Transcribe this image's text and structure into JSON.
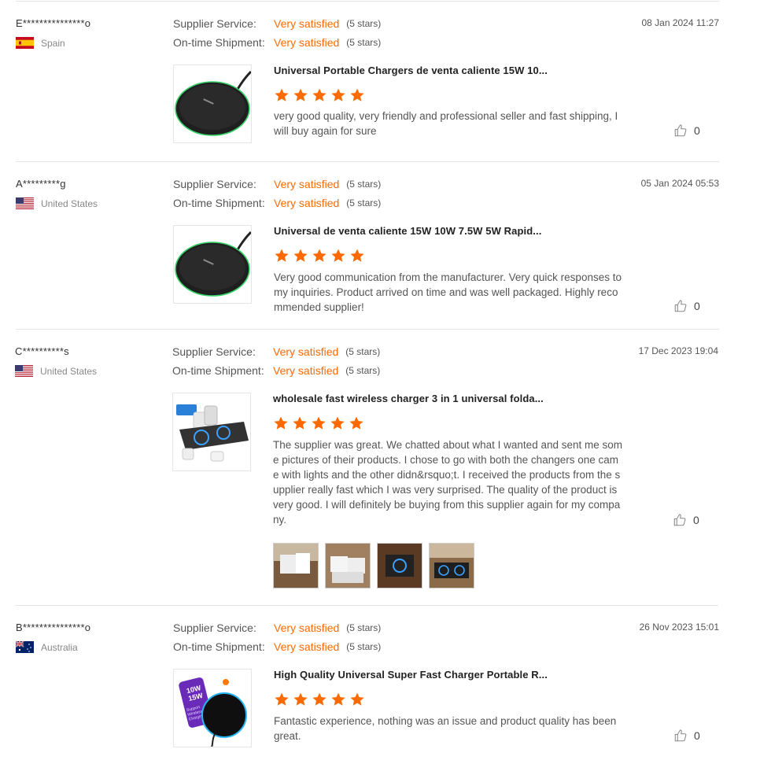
{
  "labels": {
    "supplier_service": "Supplier Service:",
    "ontime_shipment": "On-time Shipment:"
  },
  "colors": {
    "accent": "#ff6a00",
    "divider": "#e5e5e5"
  },
  "reviews": [
    {
      "name": "E***************o",
      "country": "Spain",
      "flag_icon": "spain-flag-icon",
      "supplier_service": "Very satisfied",
      "supplier_service_stars": "(5 stars)",
      "ontime_shipment": "Very satisfied",
      "ontime_shipment_stars": "(5 stars)",
      "date": "08 Jan 2024 11:27",
      "product_title": "Universal Portable Chargers de venta caliente 15W 10...",
      "rating": 5,
      "text": "very good quality, very friendly and professional seller and fast shipping, I will buy again for sure",
      "likes": "0"
    },
    {
      "name": "A*********g",
      "country": "United States",
      "flag_icon": "usa-flag-icon",
      "supplier_service": "Very satisfied",
      "supplier_service_stars": "(5 stars)",
      "ontime_shipment": "Very satisfied",
      "ontime_shipment_stars": "(5 stars)",
      "date": "05 Jan 2024 05:53",
      "product_title": "Universal de venta caliente 15W 10W 7.5W 5W Rapid...",
      "rating": 5,
      "text": "Very good communication from the manufacturer. Very quick responses to my inquiries. Product arrived on time and was well packaged. Highly recommended supplier!",
      "likes": "0"
    },
    {
      "name": "C**********s",
      "country": "United States",
      "flag_icon": "usa-flag-icon",
      "supplier_service": "Very satisfied",
      "supplier_service_stars": "(5 stars)",
      "ontime_shipment": "Very satisfied",
      "ontime_shipment_stars": "(5 stars)",
      "date": "17 Dec 2023 19:04",
      "product_title": "wholesale fast wireless charger 3 in 1 universal folda...",
      "rating": 5,
      "text": "The supplier was great. We chatted about what I wanted and sent me some pictures of their products. I chose to go with both the changers one came with lights and the other didn&rsquo;t. I received the products from the supplier really fast which I was very surprised. The quality of the product is very good. I will definitely be buying from this supplier again for my company.",
      "likes": "0"
    },
    {
      "name": "B***************o",
      "country": "Australia",
      "flag_icon": "australia-flag-icon",
      "supplier_service": "Very satisfied",
      "supplier_service_stars": "(5 stars)",
      "ontime_shipment": "Very satisfied",
      "ontime_shipment_stars": "(5 stars)",
      "date": "26 Nov 2023 15:01",
      "product_title": "High Quality Universal Super Fast Charger Portable R...",
      "rating": 5,
      "text": "Fantastic experience, nothing was an issue and product quality has been great.",
      "likes": "0",
      "product_image_text": [
        "10W",
        "15W",
        "Support",
        "Wireless",
        "Charging"
      ]
    }
  ]
}
